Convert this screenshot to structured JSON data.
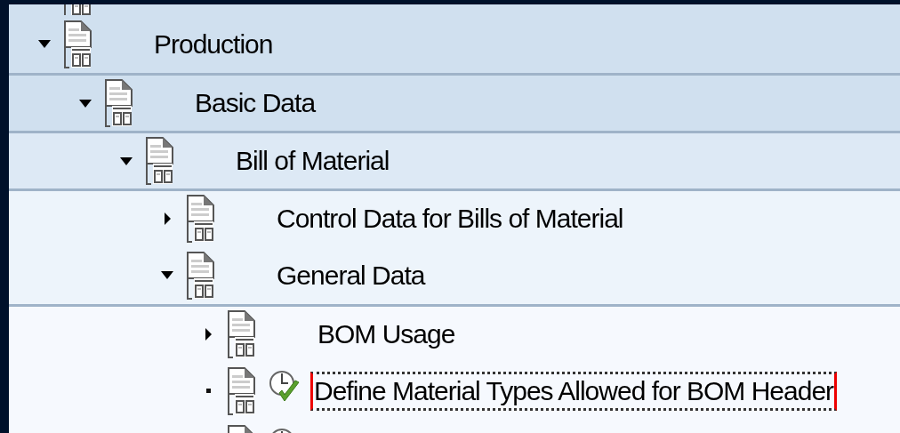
{
  "tree": [
    {
      "kind": "folder",
      "label": "Production",
      "expanded": true,
      "selected": false,
      "children": [
        {
          "kind": "folder",
          "label": "Basic Data",
          "expanded": true,
          "selected": false,
          "children": [
            {
              "kind": "folder",
              "label": "Bill of Material",
              "expanded": true,
              "selected": false,
              "children": [
                {
                  "kind": "folder",
                  "label": "Control Data for Bills of Material",
                  "expanded": false,
                  "selected": false
                },
                {
                  "kind": "folder",
                  "label": "General Data",
                  "expanded": true,
                  "selected": false,
                  "children": [
                    {
                      "kind": "folder",
                      "label": "BOM Usage",
                      "expanded": false,
                      "selected": false
                    },
                    {
                      "kind": "activity",
                      "label": "Define Material Types Allowed for BOM Header",
                      "selected": true
                    },
                    {
                      "kind": "activity",
                      "selected": false
                    }
                  ]
                }
              ]
            }
          ]
        }
      ]
    }
  ]
}
